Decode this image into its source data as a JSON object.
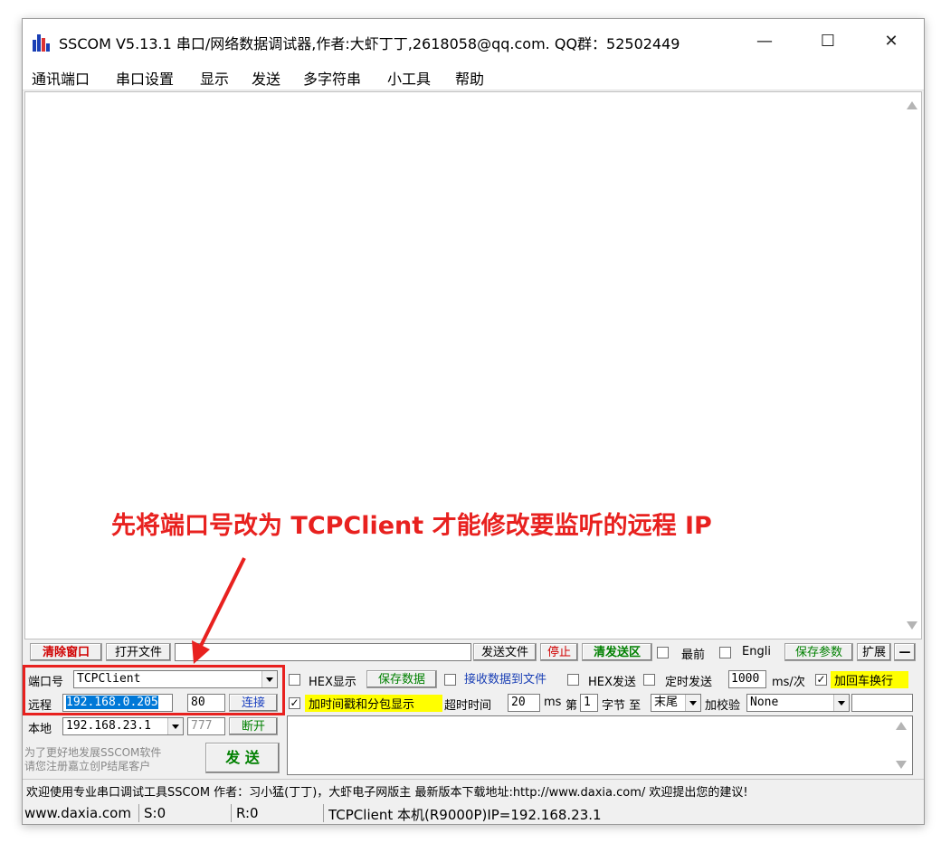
{
  "window": {
    "title": "SSCOM V5.13.1 串口/网络数据调试器,作者:大虾丁丁,2618058@qq.com. QQ群：52502449",
    "minimize": "—",
    "maximize": "☐",
    "close": "✕"
  },
  "menu": [
    "通讯端口",
    "串口设置",
    "显示",
    "发送",
    "多字符串",
    "小工具",
    "帮助"
  ],
  "annotation": "先将端口号改为 TCPClient 才能修改要监听的远程 IP",
  "toolbar": {
    "clear_window": "清除窗口",
    "open_file": "打开文件",
    "send_file": "发送文件",
    "stop": "停止",
    "clear_send": "清发送区",
    "last_label": "最前",
    "english_label": "Engli",
    "save_params": "保存参数",
    "expand": "扩展",
    "collapse": "—"
  },
  "row1": {
    "port_label": "端口号",
    "port_value": "TCPClient",
    "hex_display": "HEX显示",
    "save_data": "保存数据",
    "recv_to_file": "接收数据到文件",
    "hex_send": "HEX发送",
    "timed_send": "定时发送",
    "interval": "1000",
    "interval_unit": "ms/次",
    "add_crlf": "加回车换行"
  },
  "row2": {
    "remote_label": "远程",
    "remote_ip": "192.168.0.205",
    "remote_port": "80",
    "connect": "连接",
    "timestamp": "加时间戳和分包显示",
    "timeout_label": "超时时间",
    "timeout_value": "20",
    "timeout_unit": "ms",
    "nth_label": "第",
    "nth_value": "1",
    "byte_to": "字节 至",
    "end_value": "末尾",
    "checksum_label": "加校验",
    "checksum_value": "None"
  },
  "row3": {
    "local_label": "本地",
    "local_ip": "192.168.23.1",
    "local_port": "777",
    "disconnect": "断开"
  },
  "promo": {
    "line1": "为了更好地发展SSCOM软件",
    "line2": "请您注册嘉立创P结尾客户",
    "send": "发 送"
  },
  "marquee": "欢迎使用专业串口调试工具SSCOM  作者：习小猛(丁丁)，大虾电子网版主  最新版本下载地址:http://www.daxia.com/  欢迎提出您的建议!",
  "status": {
    "site": "www.daxia.com",
    "sent": "S:0",
    "received": "R:0",
    "info": "TCPClient 本机(R9000P)IP=192.168.23.1"
  },
  "colors": {
    "annotation": "#e8211f",
    "selection": "#0078d7",
    "highlight": "#ffff00"
  }
}
